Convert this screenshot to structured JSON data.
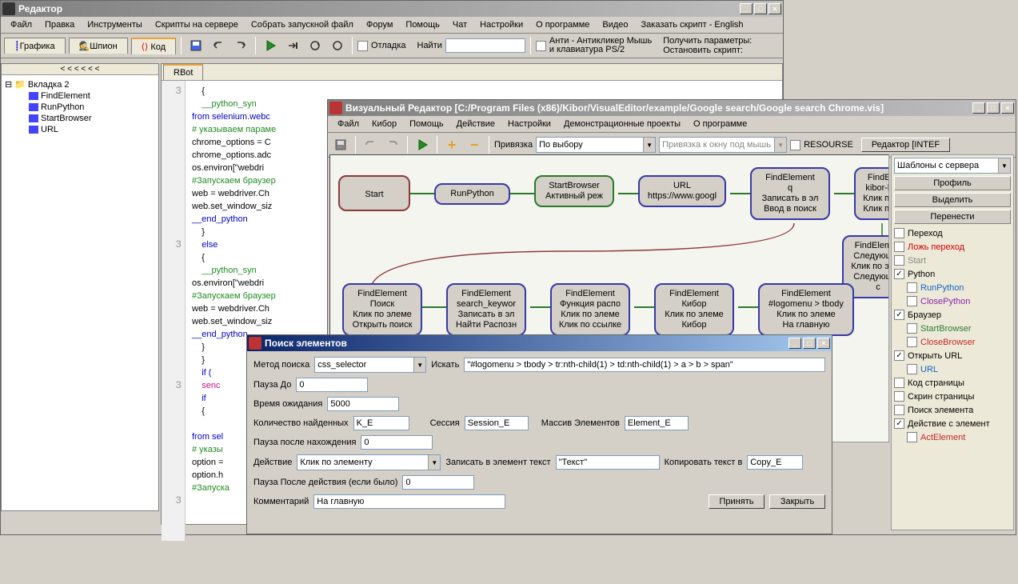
{
  "main": {
    "title": "Редактор",
    "menu": [
      "Файл",
      "Правка",
      "Инструменты",
      "Скрипты на сервере",
      "Собрать запускной файл",
      "Форум",
      "Помощь",
      "Чат",
      "Настройки",
      "О программе",
      "Видео",
      "Заказать скрипт - English"
    ],
    "tabs": {
      "graphics": "Графика",
      "spy": "Шпион",
      "code": "Код"
    },
    "toolbar": {
      "debug": "Отладка",
      "find": "Найти",
      "anti1": "Анти - Антикликер Мышь",
      "anti2": "и клавиатура PS/2",
      "get_params": "Получить параметры:",
      "stop_script": "Остановить скрипт:"
    },
    "code_tab": "RBot",
    "arrows": "< < < < < <",
    "tree": {
      "root": "Вкладка 2",
      "items": [
        "FindElement",
        "RunPython",
        "StartBrowser",
        "URL"
      ]
    },
    "gutter": [
      "3",
      "",
      "",
      "",
      "",
      "",
      "",
      "",
      "",
      "",
      "",
      "",
      "3",
      "",
      "",
      "",
      "",
      "",
      "",
      "",
      "",
      "",
      "",
      "3",
      "",
      "",
      "",
      "",
      "",
      "",
      "",
      "",
      "3",
      "",
      "",
      "",
      "",
      "",
      ""
    ],
    "code_lines": [
      {
        "t": "    {",
        "c": ""
      },
      {
        "t": "    __python_syn",
        "c": "com"
      },
      {
        "t": "from selenium.webc",
        "c": "kw"
      },
      {
        "t": "# указываем параме",
        "c": "com"
      },
      {
        "t": "chrome_options = C",
        "c": ""
      },
      {
        "t": "chrome_options.adc",
        "c": ""
      },
      {
        "t": "os.environ[\"webdri",
        "c": ""
      },
      {
        "t": "#Запускаем браузер",
        "c": "com"
      },
      {
        "t": "web = webdriver.Ch",
        "c": ""
      },
      {
        "t": "web.set_window_siz",
        "c": ""
      },
      {
        "t": "__end_python",
        "c": "kw"
      },
      {
        "t": "    }",
        "c": ""
      },
      {
        "t": "    else",
        "c": "kw"
      },
      {
        "t": "    {",
        "c": ""
      },
      {
        "t": "    __python_syn",
        "c": "com"
      },
      {
        "t": "os.environ[\"webdri",
        "c": ""
      },
      {
        "t": "#Запускаем браузер",
        "c": "com"
      },
      {
        "t": "web = webdriver.Ch",
        "c": ""
      },
      {
        "t": "web.set_window_siz",
        "c": ""
      },
      {
        "t": "__end_python",
        "c": "kw"
      },
      {
        "t": "    }",
        "c": ""
      },
      {
        "t": "    }",
        "c": ""
      },
      {
        "t": "    if (",
        "c": "kw"
      },
      {
        "t": "    senc",
        "c": "fn"
      },
      {
        "t": "    if",
        "c": "kw"
      },
      {
        "t": "    {",
        "c": ""
      },
      {
        "t": "",
        "c": ""
      },
      {
        "t": "from sel",
        "c": "kw"
      },
      {
        "t": "# указы",
        "c": "com"
      },
      {
        "t": "option =",
        "c": ""
      },
      {
        "t": "option.h",
        "c": ""
      },
      {
        "t": "#Запуска",
        "c": "com"
      }
    ]
  },
  "visual": {
    "title": "Визуальный Редактор [C:/Program Files (x86)/Kibor/VisualEditor/example/Google search/Google search Chrome.vis]",
    "menu": [
      "Файл",
      "Кибор",
      "Помощь",
      "Действие",
      "Настройки",
      "Демонстрационные проекты",
      "О программе"
    ],
    "binding": "Привязка",
    "binding_val": "По выбору",
    "binding2": "Привязка к окну под мышь",
    "resource": "RESOURSE",
    "editor_btn": "Редактор [INTEF",
    "templates": "Шаблоны с сервера",
    "profile": "Профиль",
    "select": "Выделить",
    "move": "Перенести",
    "checks": {
      "transition": "Переход",
      "false_trans": "Ложь переход",
      "start": "Start",
      "python": "Python",
      "runpy": "RunPython",
      "closepy": "ClosePython",
      "browser": "Браузер",
      "startbr": "StartBrowser",
      "closebr": "CloseBrowser",
      "openurl": "Открыть URL",
      "url": "URL",
      "pagecode": "Код страницы",
      "pageshot": "Скрин страницы",
      "findel": "Поиск элемента",
      "action": "Действие с элемент",
      "actel": "ActElement"
    },
    "nodes": {
      "start": "Start",
      "runpy": "RunPython",
      "startbr": {
        "l1": "StartBrowser",
        "l2": "Активный реж"
      },
      "url": {
        "l1": "URL",
        "l2": "https://www.googl"
      },
      "fe_q": {
        "l1": "FindElement",
        "l2": "q",
        "l3": "Записать в эл",
        "l4": "Ввод в поиск"
      },
      "fe_kibor": {
        "l1": "FindElemer",
        "l2": "kibor-bot.cor",
        "l3": "Клик по элем",
        "l4": "Клик по ссыл"
      },
      "fe_next": {
        "l1": "FindElemen",
        "l2": "Следующая",
        "l3": "Клик по элем",
        "l4": "Следующая с"
      },
      "fe_search": {
        "l1": "FindElement",
        "l2": "Поиск",
        "l3": "Клик по элеме",
        "l4": "Открыть поиск"
      },
      "fe_keyword": {
        "l1": "FindElement",
        "l2": "search_keywor",
        "l3": "Записать в эл",
        "l4": "Найти Распозн"
      },
      "fe_func": {
        "l1": "FindElement",
        "l2": "Функция распо",
        "l3": "Клик по элеме",
        "l4": "Клик по ссылке"
      },
      "fe_kibor2": {
        "l1": "FindElement",
        "l2": "Кибор",
        "l3": "Клик по элеме",
        "l4": "Кибор"
      },
      "fe_logo": {
        "l1": "FindElement",
        "l2": "#logomenu > tbody",
        "l3": "Клик по элеме",
        "l4": "На главную"
      }
    }
  },
  "dlg": {
    "title": "Поиск элементов",
    "method": "Метод поиска",
    "method_val": "css_selector",
    "search": "Искать",
    "search_val": "\"#logomenu > tbody > tr:nth-child(1) > td:nth-child(1) > a > b > span\"",
    "pause_before": "Пауза До",
    "pause_before_val": "0",
    "wait": "Время ожидания",
    "wait_val": "5000",
    "count": "Количество найденных",
    "count_val": "K_E",
    "session": "Сессия",
    "session_val": "Session_E",
    "array": "Массив Элементов",
    "array_val": "Element_E",
    "pause_after_find": "Пауза после нахождения",
    "pause_after_find_val": "0",
    "action": "Действие",
    "action_val": "Клик по элементу",
    "write": "Записать в элемент текст",
    "write_val": "\"Текст\"",
    "copy": "Копировать текст в",
    "copy_val": "Copy_E",
    "pause_after": "Пауза После действия (если было)",
    "pause_after_val": "0",
    "comment": "Комментарий",
    "comment_val": "На главную",
    "accept": "Принять",
    "close": "Закрыть"
  }
}
